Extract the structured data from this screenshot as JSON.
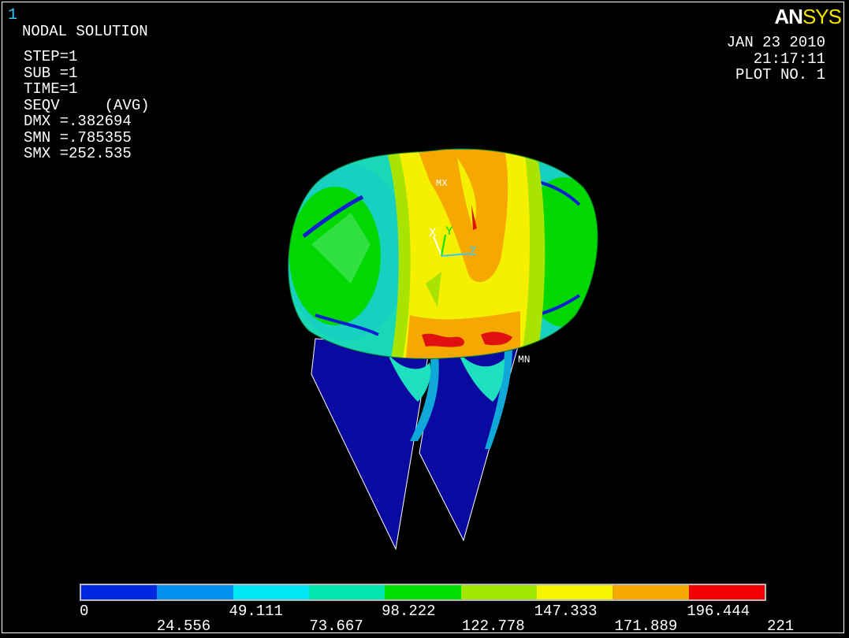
{
  "window_number": "1",
  "logo": {
    "part1": "AN",
    "part2": "SYS"
  },
  "info": {
    "title": "NODAL SOLUTION",
    "step": "STEP=1",
    "sub": "SUB =1",
    "time": "TIME=1",
    "result": "SEQV     (AVG)",
    "dmx": "DMX =.382694",
    "smn": "SMN =.785355",
    "smx": "SMX =252.535"
  },
  "stamp": {
    "date": "JAN 23 2010",
    "time": "21:17:11",
    "plot": "PLOT NO.   1"
  },
  "markers": {
    "max": "MX",
    "min": "MN"
  },
  "triad": {
    "x": "X",
    "y": "Y",
    "z": "Z"
  },
  "legend": {
    "colors": [
      "#0028e0",
      "#0090f0",
      "#00e8f8",
      "#00e8b0",
      "#00e000",
      "#a0e800",
      "#f5f500",
      "#f5a800",
      "#f00000"
    ],
    "ticks_top": [
      "0",
      "49.111",
      "98.222",
      "147.333",
      "196.444"
    ],
    "ticks_bottom": [
      "24.556",
      "73.667",
      "122.778",
      "171.889",
      "221"
    ]
  }
}
